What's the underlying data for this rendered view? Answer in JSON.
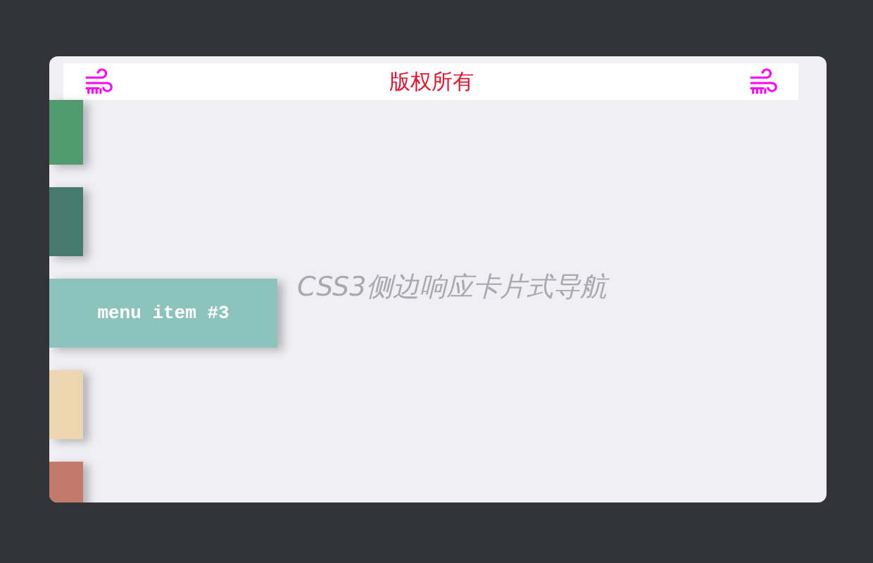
{
  "header": {
    "title": "版权所有"
  },
  "menu": [
    {
      "color": "#519b70",
      "expanded": false
    },
    {
      "color": "#467a6e",
      "expanded": false
    },
    {
      "color": "#8cc4bd",
      "expanded": true,
      "label": "menu item #3"
    },
    {
      "color": "#ecd6b2",
      "expanded": false
    },
    {
      "color": "#c47a6a",
      "expanded": false
    }
  ],
  "heading": "CSS3侧边响应卡片式导航"
}
